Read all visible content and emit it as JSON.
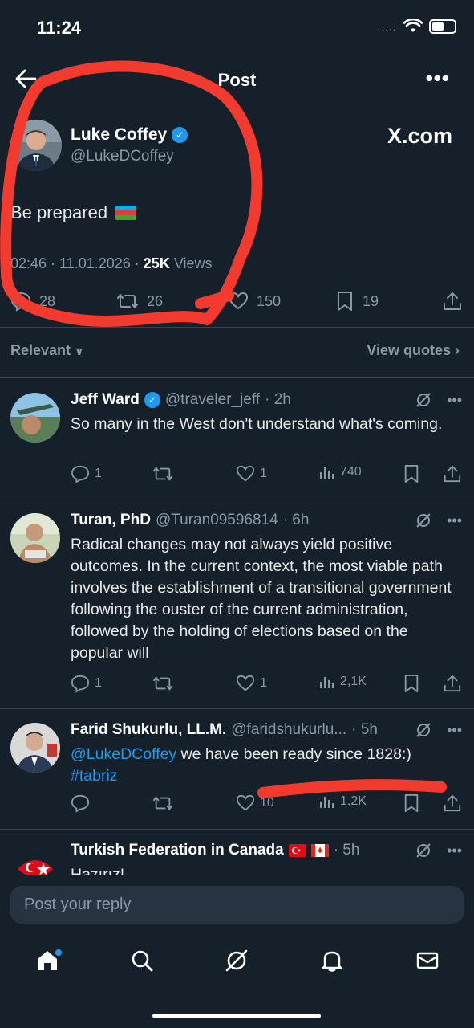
{
  "status_bar": {
    "time": "11:24",
    "signal": "....."
  },
  "topbar": {
    "title": "Post"
  },
  "main_post": {
    "author_name": "Luke Coffey",
    "author_handle": "@LukeDCoffey",
    "watermark": "X.com",
    "text": "Be prepared",
    "timestamp": "02:46 · 11.01.2026 · ",
    "views_count": "25K",
    "views_label": " Views",
    "replies": "28",
    "reposts": "26",
    "likes": "150",
    "bookmarks": "19"
  },
  "filter": {
    "sort": "Relevant",
    "view_quotes": "View quotes"
  },
  "replies": [
    {
      "name": "Jeff Ward",
      "handle": "@traveler_jeff",
      "time": "· 2h",
      "text": "So many in the West don't understand what's coming.",
      "replies": "1",
      "reposts": "",
      "likes": "1",
      "views": "740"
    },
    {
      "name": "Turan, PhD",
      "handle": "@Turan09596814",
      "time": "· 6h",
      "text": "Radical changes may not always yield positive outcomes. In the current context, the most viable path involves the establishment of a transitional government following the ouster of the current administration, followed by the holding of elections based on the popular will",
      "replies": "1",
      "reposts": "",
      "likes": "1",
      "views": "2,1K"
    },
    {
      "name": "Farid Shukurlu, LL.M.",
      "handle": "@faridshukurlu...",
      "time": "· 5h",
      "mention": "@LukeDCoffey",
      "text": " we have been ready since 1828:)",
      "hashtag": "#tabriz",
      "replies": "",
      "reposts": "",
      "likes": "10",
      "views": "1,2K"
    },
    {
      "name": "Turkish Federation in Canada",
      "time": "· 5h",
      "text": "Hazırız!"
    }
  ],
  "reply_box": {
    "placeholder": "Post your reply"
  },
  "colors": {
    "background": "#15202b",
    "accent": "#1d9bf0",
    "muted": "#8b98a5",
    "annotation": "#f23a2f"
  }
}
